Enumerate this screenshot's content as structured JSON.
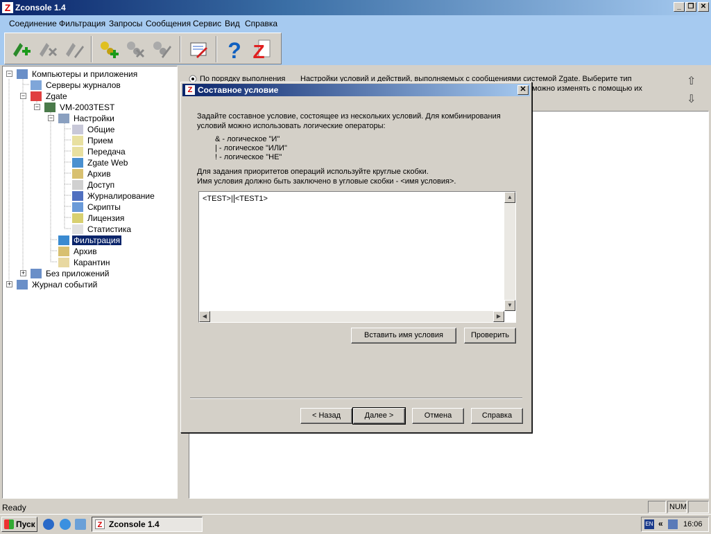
{
  "app": {
    "title": "Zconsole 1.4",
    "logo_letter": "Z"
  },
  "window_controls": {
    "minimize": "_",
    "maximize": "❐",
    "close": "✕"
  },
  "menu": [
    "Соединение",
    "Фильтрация",
    "Запросы",
    "Сообщения",
    "Сервис",
    "Вид",
    "Справка"
  ],
  "toolbar": {
    "buttons": [
      "add-connection",
      "remove-connection",
      "edit-connection",
      "add-rule",
      "remove-rule",
      "edit-rule",
      "edit-log",
      "help",
      "about-zgate"
    ],
    "help_glyph": "?",
    "z_glyph": "Z"
  },
  "tree": {
    "nodes": [
      {
        "label": "Компьютеры и приложения",
        "expander": "−"
      },
      {
        "label": "Серверы журналов"
      },
      {
        "label": "Zgate",
        "expander": "−"
      },
      {
        "label": "VM-2003TEST",
        "expander": "−"
      },
      {
        "label": "Настройки",
        "expander": "−"
      },
      {
        "label": "Общие"
      },
      {
        "label": "Прием"
      },
      {
        "label": "Передача"
      },
      {
        "label": "Zgate Web"
      },
      {
        "label": "Архив"
      },
      {
        "label": "Доступ"
      },
      {
        "label": "Журналирование"
      },
      {
        "label": "Скрипты"
      },
      {
        "label": "Лицензия"
      },
      {
        "label": "Статистика"
      },
      {
        "label": "Фильтрация"
      },
      {
        "label": "Архив"
      },
      {
        "label": "Карантин"
      },
      {
        "label": "Без приложений",
        "expander": "+"
      },
      {
        "label": "Журнал событий",
        "expander": "+"
      }
    ]
  },
  "right_panel": {
    "radio_label": "По порядку выполнения",
    "desc_line1": "Настройки условий и действий, выполняемых с сообщениями системой Zgate. Выберите тип",
    "desc_line2": "можно изменять с помощью их",
    "up_glyph": "⇧",
    "down_glyph": "⇩"
  },
  "dialog": {
    "title": "Составное условие",
    "close_glyph": "✕",
    "intro_line1": "Задайте составное условие, состоящее из нескольких условий. Для комбинирования",
    "intro_line2": "условий можно использовать логические операторы:",
    "op_and": "& - логическое \"И\"",
    "op_or": "| - логическое \"ИЛИ\"",
    "op_not": "! - логическое \"НЕ\"",
    "prio_line1": "Для задания приоритетов операций используйте круглые скобки.",
    "prio_line2": "Имя условия должно быть заключено в угловые скобки - <имя условия>.",
    "editor_text_before_caret": "<TEST>|",
    "editor_text_after_caret": "<TEST1>",
    "insert_button": "Вставить имя условия",
    "check_button": "Проверить",
    "back_button": "< Назад",
    "next_button": "Далее >",
    "cancel_button": "Отмена",
    "help_button": "Справка",
    "scroll_up": "▲",
    "scroll_down": "▼",
    "scroll_left": "◀",
    "scroll_right": "▶"
  },
  "statusbar": {
    "ready": "Ready",
    "num": "NUM"
  },
  "taskbar": {
    "start": "Пуск",
    "task": "Zconsole 1.4",
    "lang": "EN",
    "tray_chevron": "«",
    "clock": "16:06"
  }
}
